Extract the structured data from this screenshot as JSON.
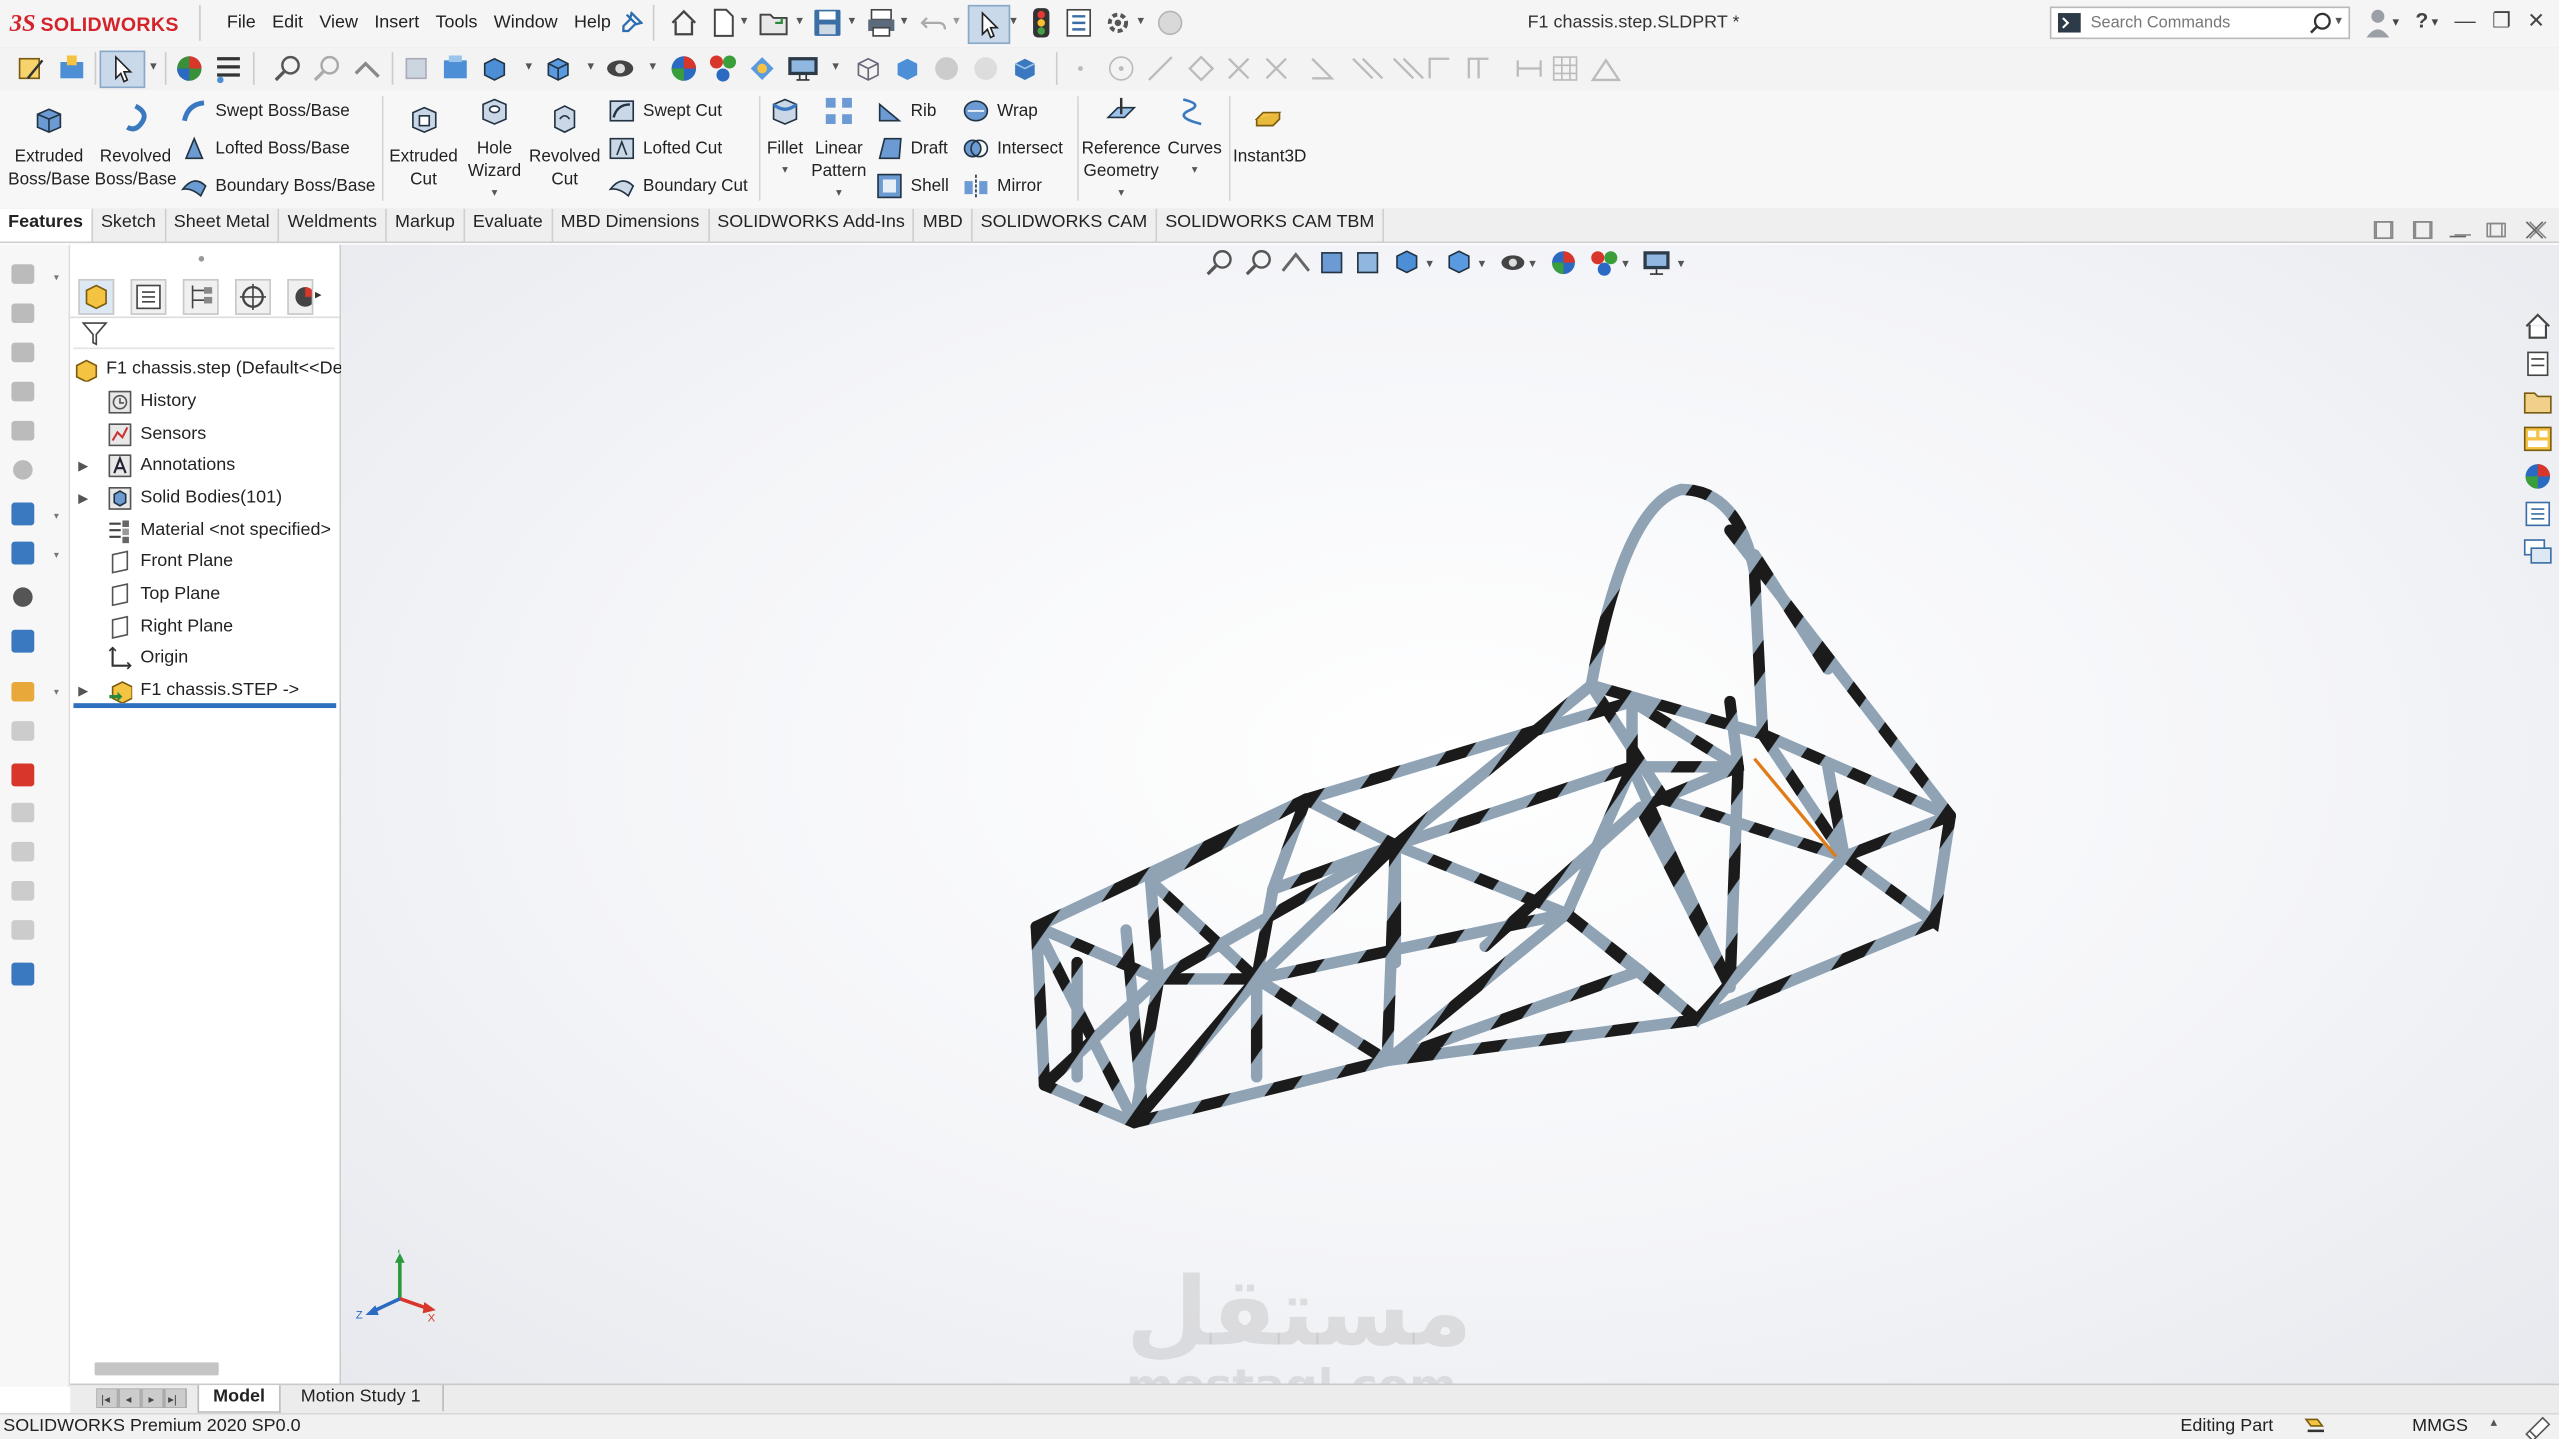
{
  "app": {
    "name": "SOLIDWORKS",
    "document_title": "F1 chassis.step.SLDPRT *"
  },
  "menu": [
    "File",
    "Edit",
    "View",
    "Insert",
    "Tools",
    "Window",
    "Help"
  ],
  "search": {
    "placeholder": "Search Commands"
  },
  "features_toolbar": {
    "extruded_boss": "Extruded Boss/Base",
    "revolved_boss": "Revolved Boss/Base",
    "swept_boss": "Swept Boss/Base",
    "lofted_boss": "Lofted Boss/Base",
    "boundary_boss": "Boundary Boss/Base",
    "extruded_cut": "Extruded Cut",
    "hole_wizard": "Hole Wizard",
    "revolved_cut": "Revolved Cut",
    "swept_cut": "Swept Cut",
    "lofted_cut": "Lofted Cut",
    "boundary_cut": "Boundary Cut",
    "fillet": "Fillet",
    "linear_pattern": "Linear Pattern",
    "rib": "Rib",
    "draft": "Draft",
    "shell": "Shell",
    "wrap": "Wrap",
    "intersect": "Intersect",
    "mirror": "Mirror",
    "reference_geometry": "Reference Geometry",
    "curves": "Curves",
    "instant3d": "Instant3D"
  },
  "command_tabs": [
    "Features",
    "Sketch",
    "Sheet Metal",
    "Weldments",
    "Markup",
    "Evaluate",
    "MBD Dimensions",
    "SOLIDWORKS Add-Ins",
    "MBD",
    "SOLIDWORKS CAM",
    "SOLIDWORKS CAM TBM"
  ],
  "feature_tree": {
    "root": "F1 chassis.step  (Default<<De",
    "items": [
      {
        "label": "History",
        "icon": "history-icon",
        "expandable": false
      },
      {
        "label": "Sensors",
        "icon": "sensors-icon",
        "expandable": false
      },
      {
        "label": "Annotations",
        "icon": "annotations-icon",
        "expandable": true
      },
      {
        "label": "Solid Bodies(101)",
        "icon": "solid-bodies-icon",
        "expandable": true
      },
      {
        "label": "Material <not specified>",
        "icon": "material-icon",
        "expandable": false
      },
      {
        "label": "Front Plane",
        "icon": "plane-icon",
        "expandable": false
      },
      {
        "label": "Top Plane",
        "icon": "plane-icon",
        "expandable": false
      },
      {
        "label": "Right Plane",
        "icon": "plane-icon",
        "expandable": false
      },
      {
        "label": "Origin",
        "icon": "origin-icon",
        "expandable": false
      },
      {
        "label": "F1 chassis.STEP ->",
        "icon": "imported-feature-icon",
        "expandable": true
      }
    ]
  },
  "bottom_tabs": [
    "Model",
    "Motion Study 1"
  ],
  "status": {
    "product": "SOLIDWORKS Premium 2020 SP0.0",
    "mode": "Editing Part",
    "units": "MMGS"
  },
  "watermark": {
    "arabic": "مستقل",
    "latin": "mostaql.com"
  },
  "colors": {
    "brand": "#d4242b",
    "tube_light": "#8fa3b5",
    "tube_dark": "#1b1b1b",
    "selection": "#e07b18"
  }
}
